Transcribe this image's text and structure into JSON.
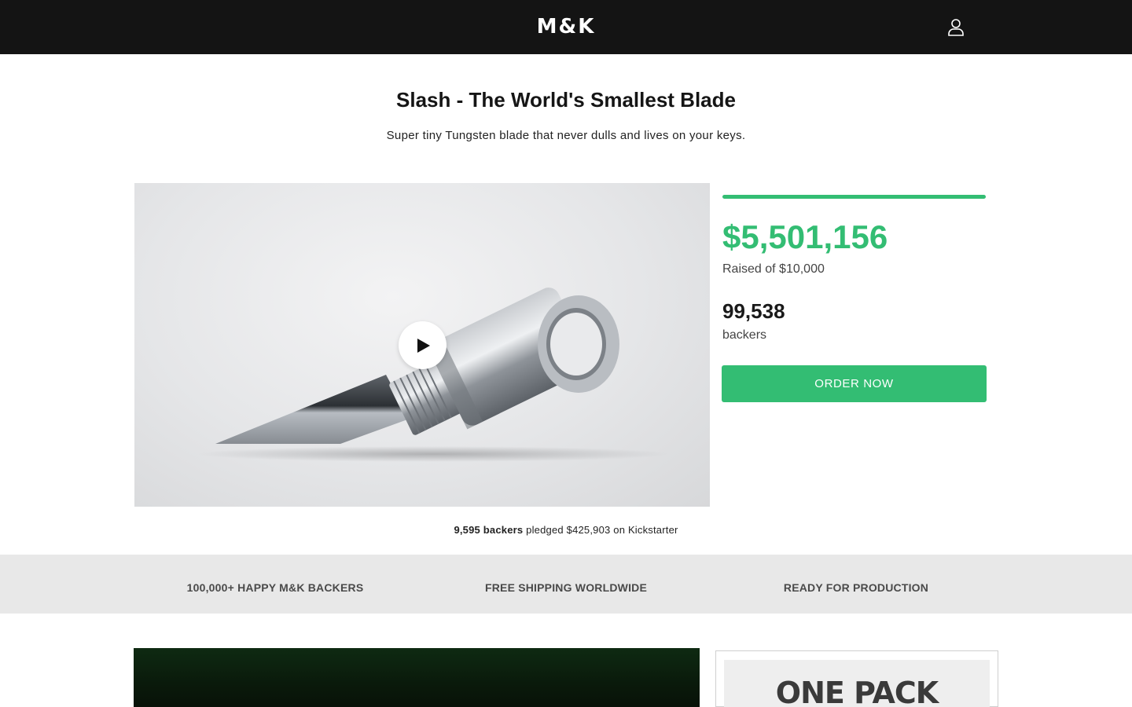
{
  "header": {
    "logo": "M&K",
    "account_icon": "user-icon"
  },
  "product": {
    "title": "Slash - The World's Smallest Blade",
    "subtitle": "Super tiny Tungsten blade that never dulls and lives on your keys."
  },
  "video": {
    "play_icon": "play-icon"
  },
  "campaign": {
    "progress_fraction": 1.0,
    "raised": "$5,501,156",
    "raised_of": "Raised of $10,000",
    "backers_count": "99,538",
    "backers_label": "backers",
    "order_button": "ORDER NOW",
    "accent_color": "#33bd73"
  },
  "kickstarter": {
    "backers": "9,595 backers",
    "rest": "pledged $425,903 on Kickstarter"
  },
  "features": [
    "100,000+ HAPPY M&K BACKERS",
    "FREE SHIPPING WORLDWIDE",
    "READY FOR PRODUCTION"
  ],
  "promo": {
    "right_text": "ONE PACK"
  }
}
